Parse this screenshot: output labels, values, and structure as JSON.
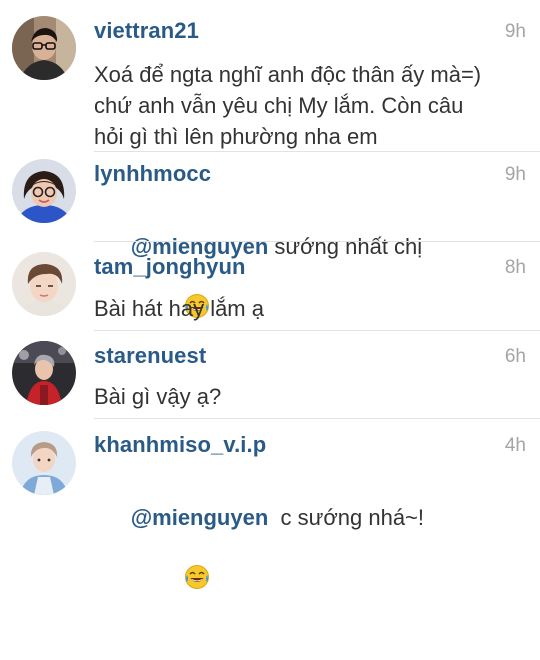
{
  "comments": [
    {
      "username": "viettran21",
      "time": "9h",
      "text": "Xoá để ngta nghĩ anh độc thân ấy mà=)\nchứ anh vẫn yêu chị My lắm. Còn câu\nhỏi gì thì lên phường nha em",
      "avatar_icon": "avatar-man-glasses"
    },
    {
      "username": "lynhhmocc",
      "time": "9h",
      "mention": "@mienguyen",
      "text": " sướng nhất chị",
      "emoji_icon": "tears-of-joy-emoji",
      "avatar_icon": "avatar-girl-glasses"
    },
    {
      "username": "tam_jonghyun",
      "time": "8h",
      "text": "Bài hát hay lắm ạ",
      "avatar_icon": "avatar-young-man"
    },
    {
      "username": "starenuest",
      "time": "6h",
      "text": "Bài gì vậy ạ?",
      "avatar_icon": "avatar-performer-red"
    },
    {
      "username": "khanhmiso_v.i.p",
      "time": "4h",
      "mention": "@mienguyen",
      "text": "  c sướng nhá~!",
      "emoji_icon": "tears-of-joy-emoji",
      "avatar_icon": "avatar-person-blue"
    }
  ],
  "colors": {
    "username": "#2a5a86",
    "text": "#333333",
    "time": "#a5a5a5",
    "divider": "#e3e3e3"
  }
}
